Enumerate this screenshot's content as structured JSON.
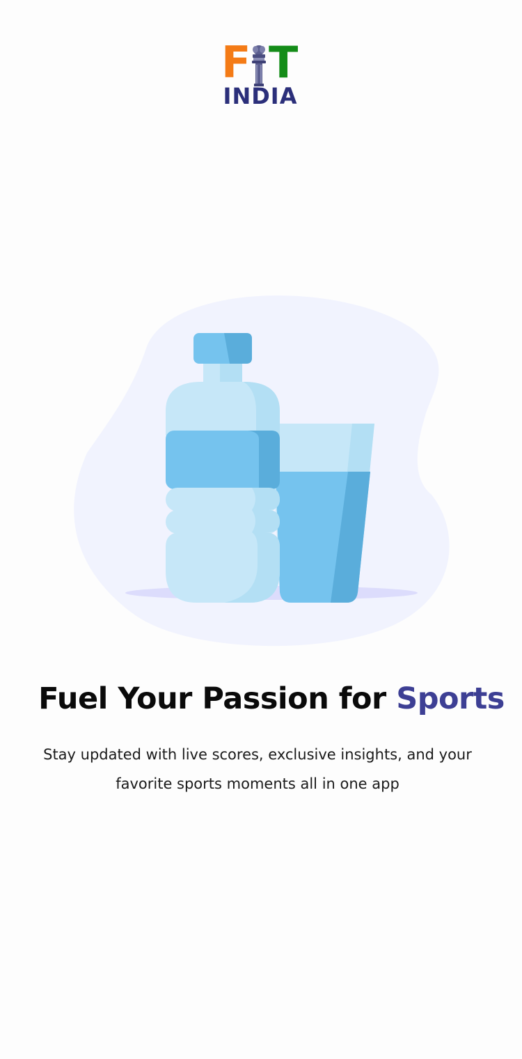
{
  "logo": {
    "letter_f": "F",
    "letter_t": "T",
    "subtitle": "INDIA",
    "colors": {
      "f": "#f47b16",
      "t": "#148c18",
      "india": "#2b2f7a"
    }
  },
  "illustration": {
    "name": "water-bottle-and-glass-illustration",
    "colors": {
      "blob": "#f1f3fe",
      "light_blue": "#c6e7f8",
      "mid_blue": "#75c3ee",
      "dark_blue": "#5aaddb",
      "shadow": "#dcdcfc"
    }
  },
  "onboarding": {
    "headline_main": "Fuel Your Passion for ",
    "headline_accent": "Sports",
    "accent_color": "#3d3f94",
    "subtitle": "Stay updated with live scores, exclusive insights, and your favorite sports moments all in one app"
  }
}
